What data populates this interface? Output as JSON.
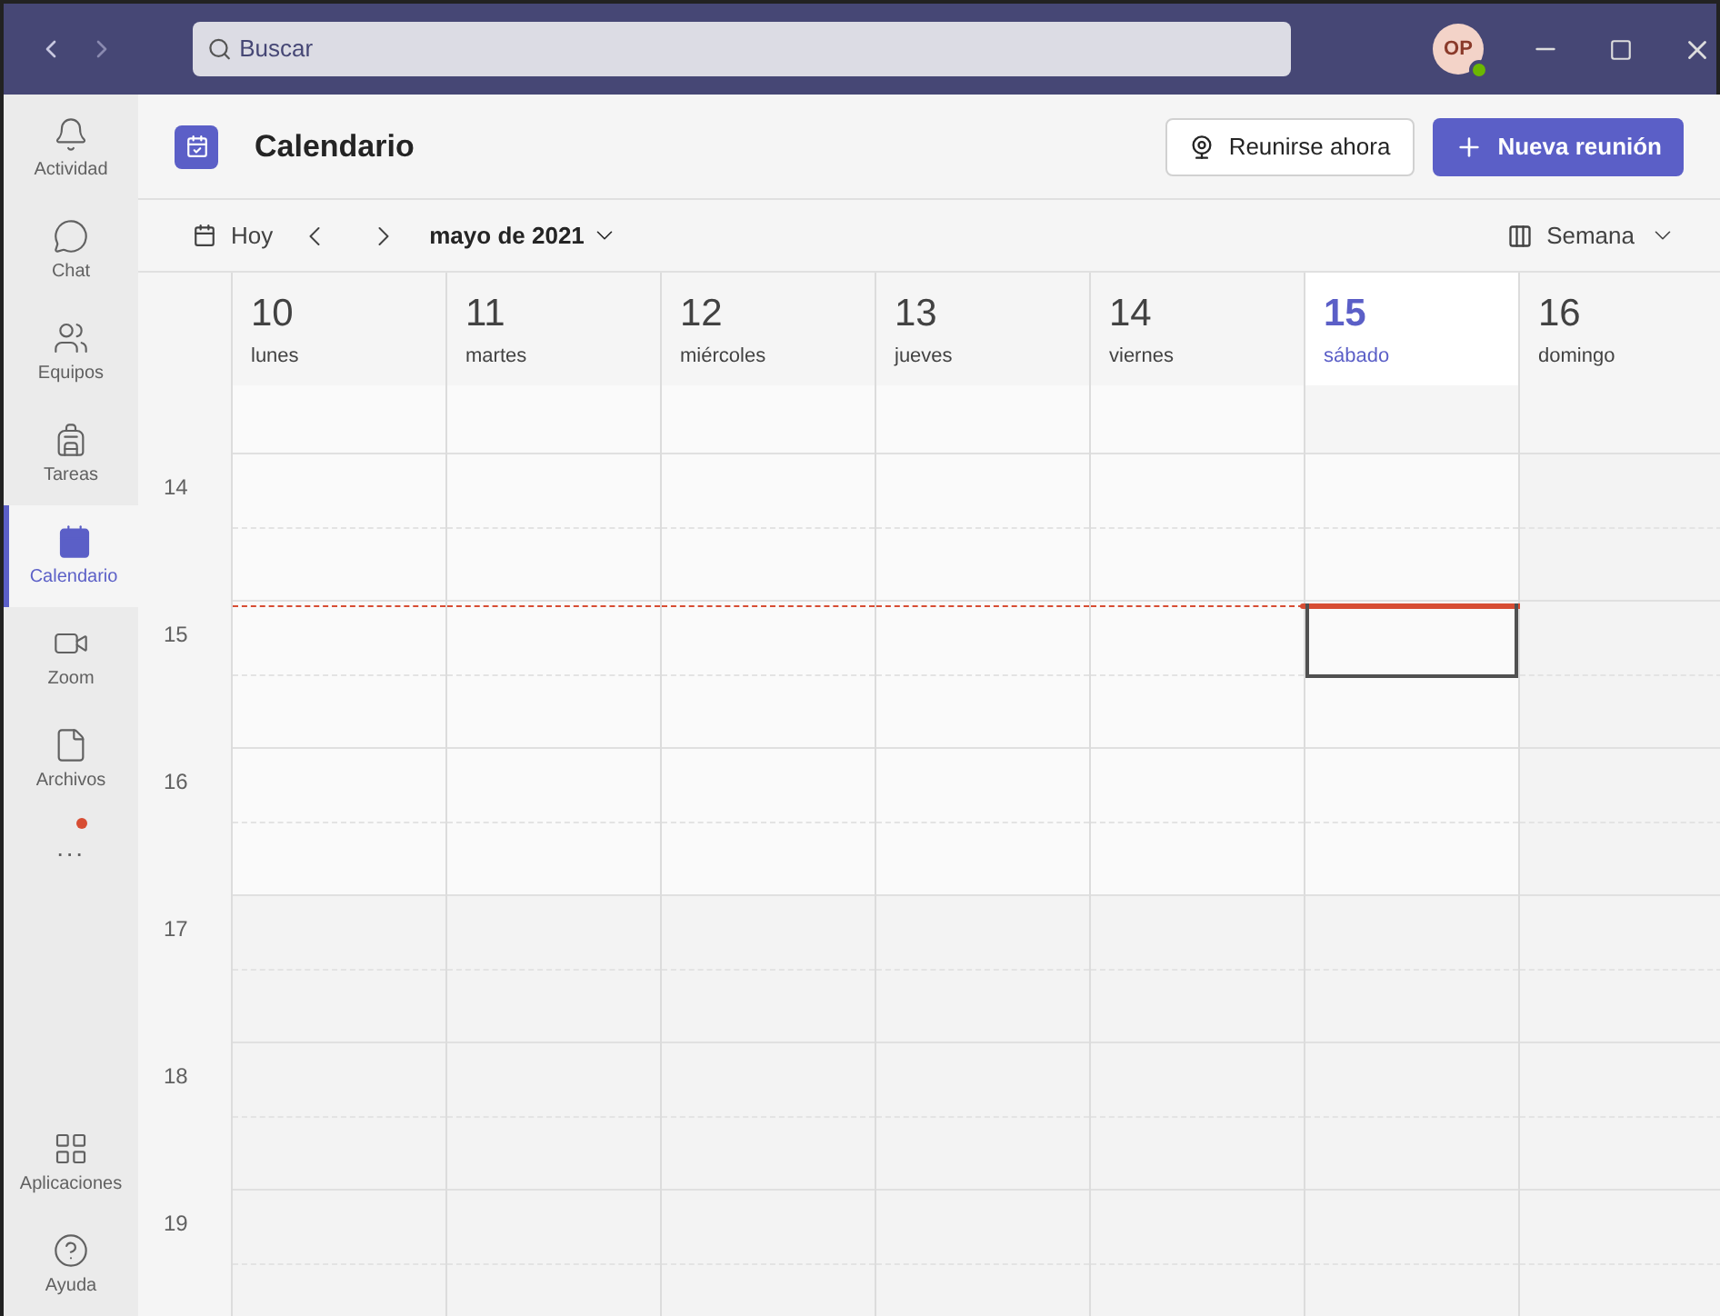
{
  "search": {
    "placeholder": "Buscar"
  },
  "avatar": {
    "initials": "OP"
  },
  "sidebar": {
    "items": [
      {
        "kind": "bell",
        "label": "Actividad",
        "selected": false
      },
      {
        "kind": "chat",
        "label": "Chat",
        "selected": false
      },
      {
        "kind": "teams",
        "label": "Equipos",
        "selected": false
      },
      {
        "kind": "tasks",
        "label": "Tareas",
        "selected": false
      },
      {
        "kind": "calendar",
        "label": "Calendario",
        "selected": true
      },
      {
        "kind": "video",
        "label": "Zoom",
        "selected": false
      },
      {
        "kind": "file",
        "label": "Archivos",
        "selected": false
      }
    ],
    "more": {
      "label": "...",
      "notification": true
    },
    "bottom": [
      {
        "kind": "apps",
        "label": "Aplicaciones",
        "selected": false
      },
      {
        "kind": "help",
        "label": "Ayuda",
        "selected": false
      }
    ]
  },
  "header": {
    "title": "Calendario",
    "meet_now": "Reunirse ahora",
    "new_meeting": "Nueva reunión"
  },
  "toolbar": {
    "today": "Hoy",
    "month": "mayo de 2021",
    "view": "Semana"
  },
  "days": [
    {
      "number": "10",
      "name": "lunes",
      "selected": false
    },
    {
      "number": "11",
      "name": "martes",
      "selected": false
    },
    {
      "number": "12",
      "name": "miércoles",
      "selected": false
    },
    {
      "number": "13",
      "name": "jueves",
      "selected": false
    },
    {
      "number": "14",
      "name": "viernes",
      "selected": false
    },
    {
      "number": "15",
      "name": "sábado",
      "selected": true
    },
    {
      "number": "16",
      "name": "domingo",
      "selected": false
    }
  ],
  "hours": [
    "14",
    "15",
    "16",
    "17",
    "18",
    "19"
  ]
}
